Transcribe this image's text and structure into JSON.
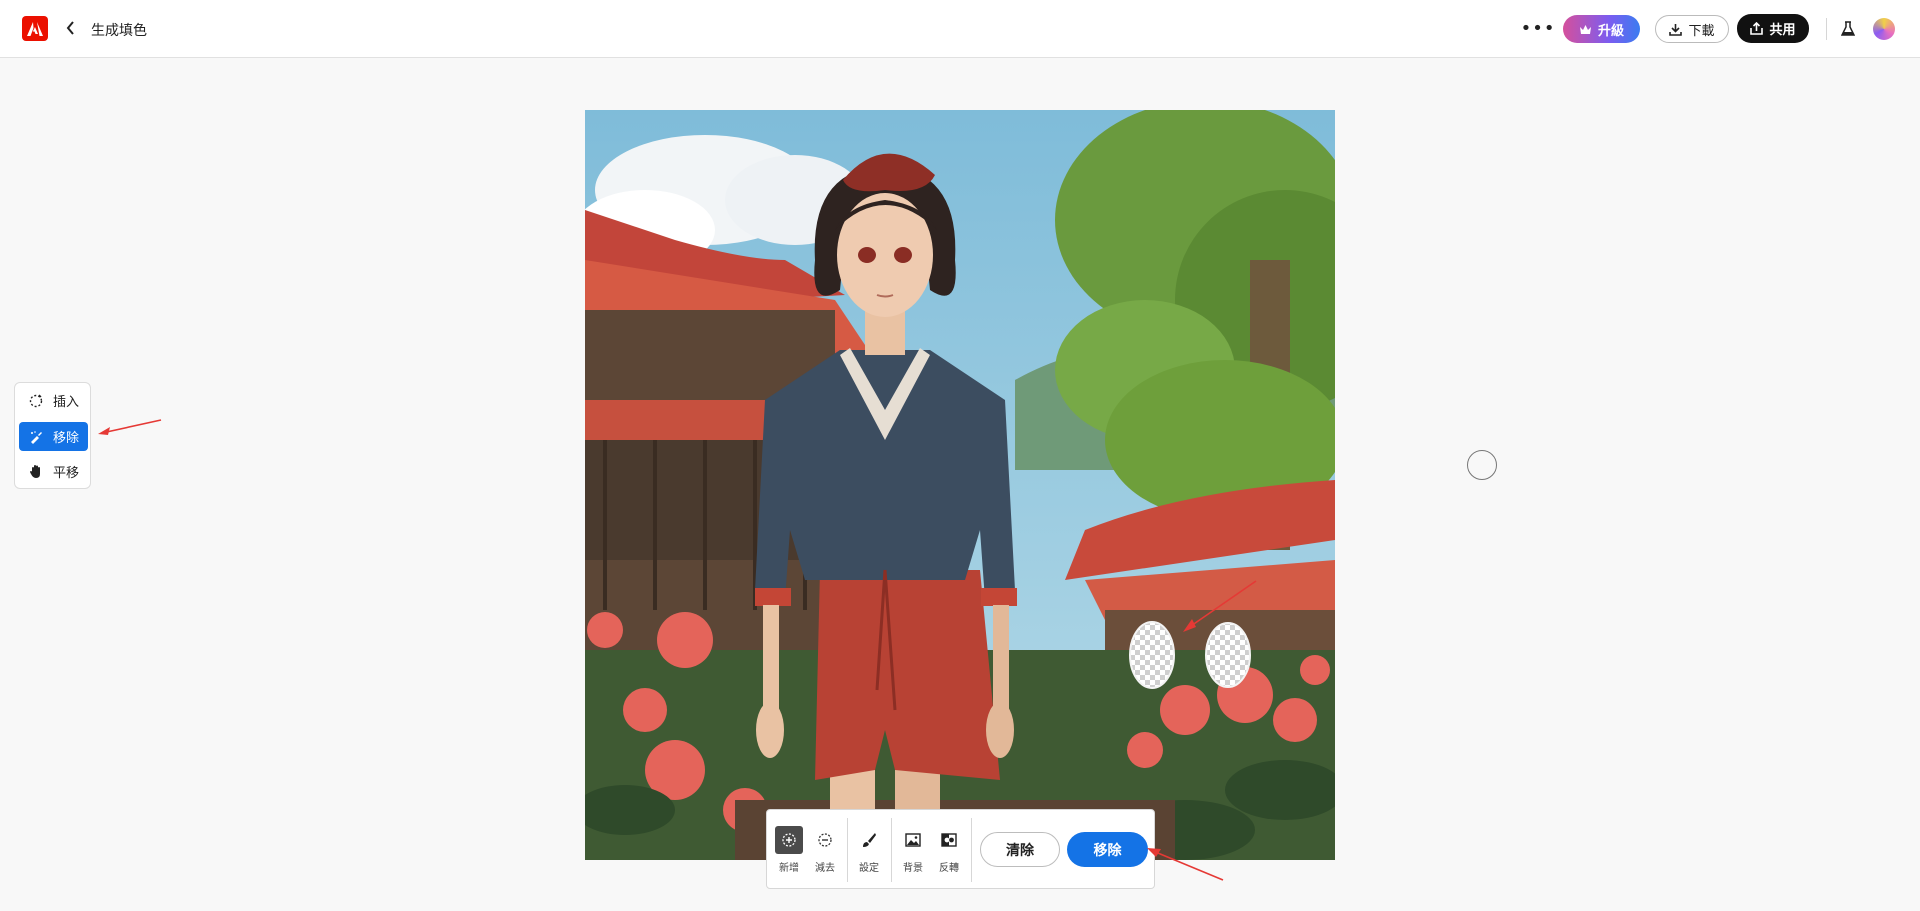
{
  "header": {
    "title": "生成填色",
    "more_label": "•••",
    "upgrade_label": "升級",
    "download_label": "下載",
    "share_label": "共用"
  },
  "tools": [
    {
      "label": "插入",
      "icon": "insert-dashed-circle-icon",
      "active": false
    },
    {
      "label": "移除",
      "icon": "remove-brush-icon",
      "active": true
    },
    {
      "label": "平移",
      "icon": "hand-pan-icon",
      "active": false
    }
  ],
  "bottombar": {
    "add_label": "新增",
    "subtract_label": "減去",
    "settings_label": "設定",
    "background_label": "背景",
    "invert_label": "反轉",
    "clear_label": "清除",
    "remove_label": "移除"
  },
  "colors": {
    "accent": "#1473e6",
    "brand": "#eb1000",
    "annotation_arrow": "#e53935"
  }
}
